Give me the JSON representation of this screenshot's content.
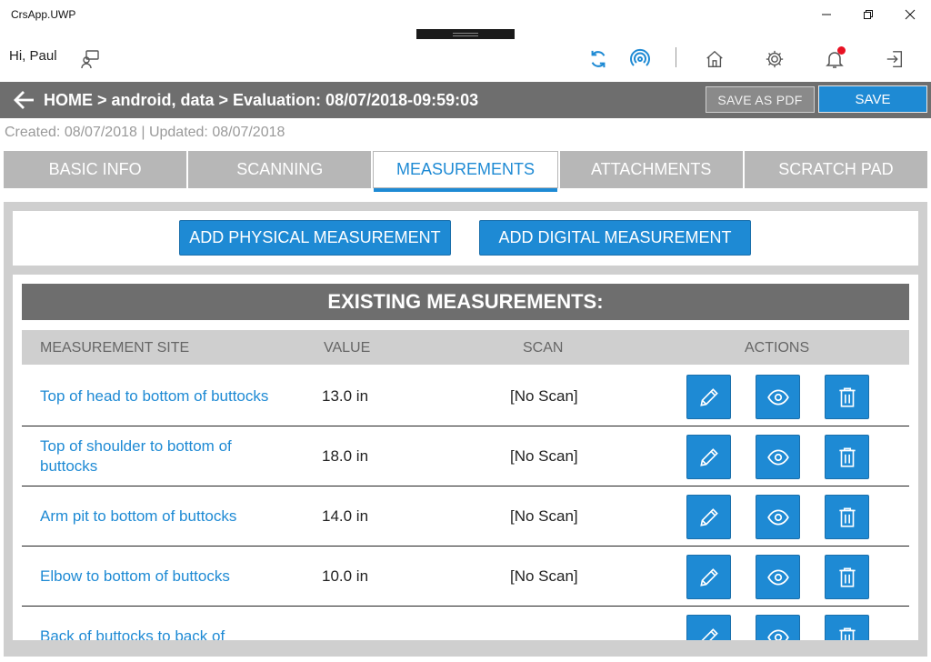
{
  "window": {
    "title": "CrsApp.UWP"
  },
  "header": {
    "greeting": "Hi, Paul",
    "icons": [
      "feedback-icon",
      "sync-icon",
      "broadcast-icon",
      "home-icon",
      "gear-icon",
      "bell-icon",
      "sign-out-icon"
    ],
    "notification_color": "#e81123"
  },
  "breadcrumb": {
    "text": "HOME > android, data > Evaluation: 08/07/2018-09:59:03",
    "save_pdf_label": "SAVE AS PDF",
    "save_label": "SAVE"
  },
  "meta": {
    "text": "Created: 08/07/2018  | Updated: 08/07/2018"
  },
  "tabs": [
    {
      "label": "BASIC INFO"
    },
    {
      "label": "SCANNING"
    },
    {
      "label": "MEASUREMENTS",
      "active": true
    },
    {
      "label": "ATTACHMENTS"
    },
    {
      "label": "SCRATCH PAD"
    }
  ],
  "actions": {
    "add_physical": "ADD PHYSICAL MEASUREMENT",
    "add_digital": "ADD DIGITAL MEASUREMENT"
  },
  "measurements": {
    "title": "EXISTING MEASUREMENTS:",
    "columns": {
      "site": "MEASUREMENT SITE",
      "value": "VALUE",
      "scan": "SCAN",
      "actions": "ACTIONS"
    },
    "rows": [
      {
        "site": "Top of head to bottom of buttocks",
        "value": "13.0  in",
        "scan": "[No Scan]"
      },
      {
        "site": "Top of shoulder to bottom of buttocks",
        "value": "18.0  in",
        "scan": "[No Scan]"
      },
      {
        "site": "Arm pit to bottom of buttocks",
        "value": "14.0  in",
        "scan": "[No Scan]"
      },
      {
        "site": "Elbow to bottom of buttocks",
        "value": "10.0  in",
        "scan": "[No Scan]"
      },
      {
        "site": "Back of buttocks to back of",
        "value": "",
        "scan": ""
      }
    ]
  },
  "colors": {
    "accent": "#1e8ad4",
    "bar_gray": "#6e6e6e",
    "tab_gray": "#b7b7b7"
  }
}
